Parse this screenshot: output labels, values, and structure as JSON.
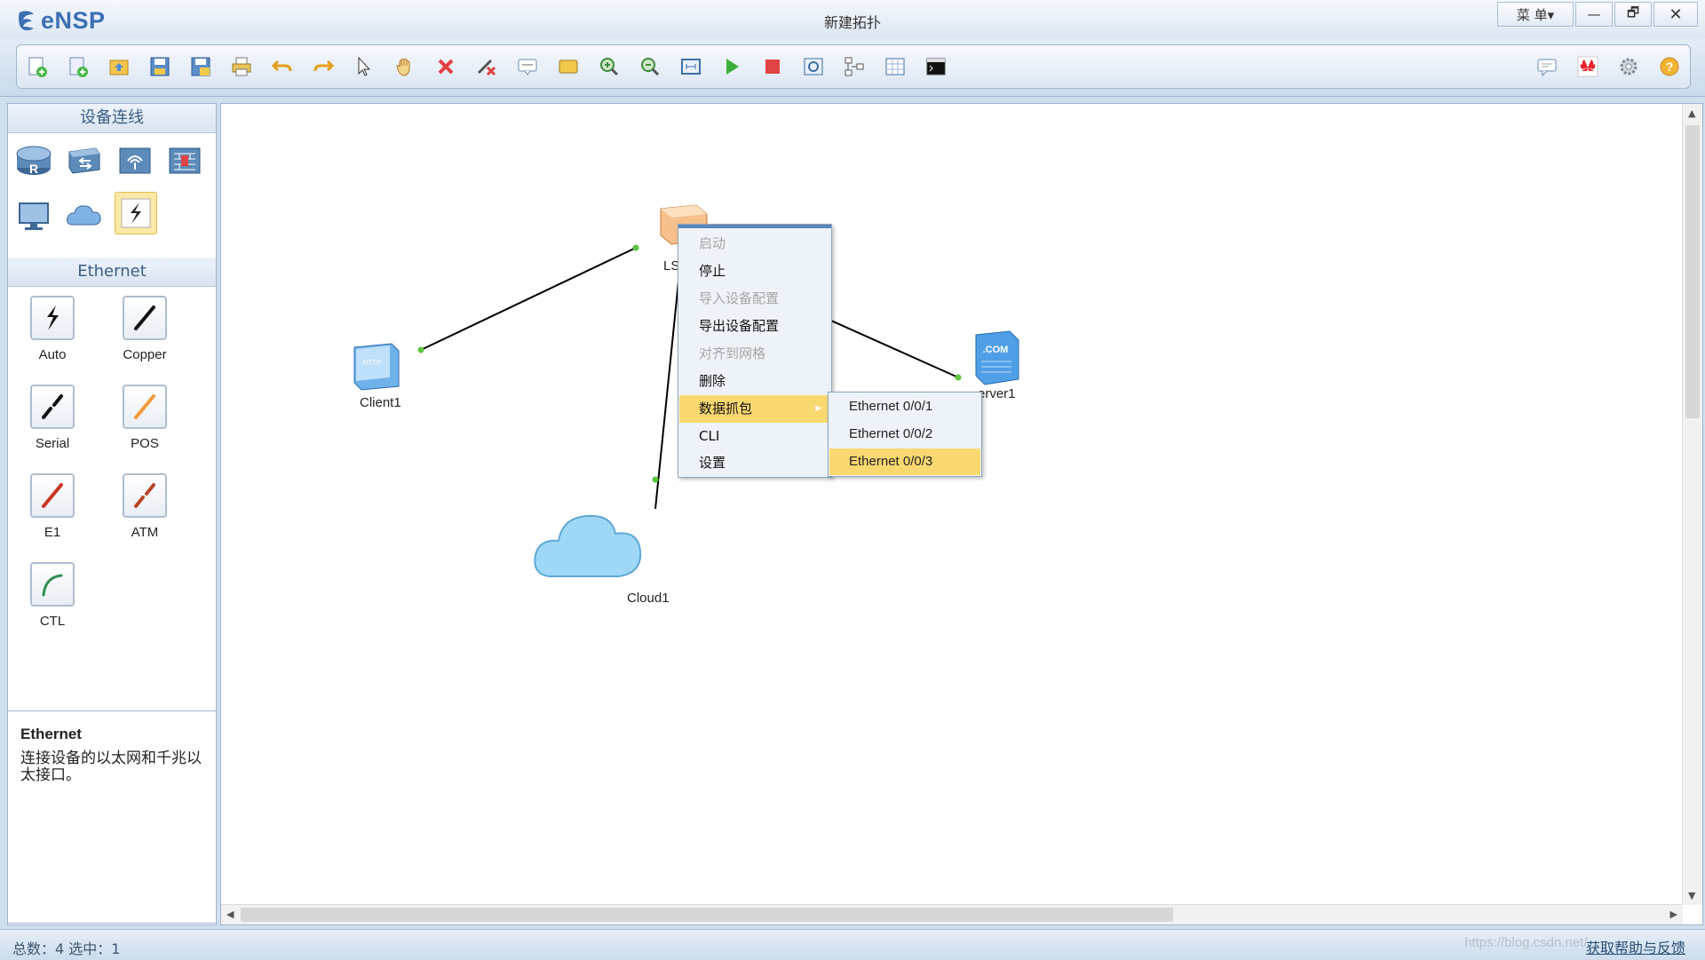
{
  "app": {
    "name": "eNSP",
    "title": "新建拓扑"
  },
  "window_controls": {
    "menu": "菜 单▾",
    "minimize": "—",
    "maximize": "🗗",
    "close": "✕"
  },
  "toolbar": {
    "left_icons": [
      "new-topology-icon",
      "new-example-icon",
      "open-icon",
      "save-icon",
      "save-as-icon",
      "print-icon",
      "undo-icon",
      "redo-icon",
      "select-pointer-icon",
      "pan-hand-icon",
      "delete-icon",
      "delete-link-icon",
      "text-annotation-icon",
      "palette-icon",
      "zoom-in-icon",
      "zoom-out-icon",
      "fit-view-icon",
      "start-device-icon",
      "stop-device-icon",
      "capture-icon",
      "topology-icon",
      "grid-table-icon",
      "terminal-icon"
    ],
    "right_icons": [
      "chat-icon",
      "huawei-logo-icon",
      "settings-gear-icon",
      "help-icon"
    ]
  },
  "left_panel": {
    "devices_header": "设备连线",
    "device_icons": [
      "router-icon",
      "switch-icon",
      "wlan-icon",
      "firewall-icon",
      "pc-icon",
      "cloud-icon",
      "connection-auto-icon"
    ],
    "ethernet_header": "Ethernet",
    "cables": [
      {
        "label": "Auto",
        "icon": "auto-cable-icon"
      },
      {
        "label": "Copper",
        "icon": "copper-cable-icon"
      },
      {
        "label": "Serial",
        "icon": "serial-cable-icon"
      },
      {
        "label": "POS",
        "icon": "pos-cable-icon"
      },
      {
        "label": "E1",
        "icon": "e1-cable-icon"
      },
      {
        "label": "ATM",
        "icon": "atm-cable-icon"
      },
      {
        "label": "CTL",
        "icon": "ctl-cable-icon"
      }
    ],
    "description": {
      "title": "Ethernet",
      "text": "连接设备的以太网和千兆以太接口。"
    }
  },
  "topology": {
    "nodes": [
      {
        "id": "client1",
        "label": "Client1",
        "icon": "http-client-icon"
      },
      {
        "id": "lsw",
        "label": "LS",
        "icon": "switch-device-icon"
      },
      {
        "id": "server1",
        "label": "erver1",
        "icon": "com-server-icon"
      },
      {
        "id": "cloud1",
        "label": "Cloud1",
        "icon": "cloud-device-icon"
      }
    ]
  },
  "context_menu": {
    "items": [
      {
        "label": "启动",
        "state": "disabled"
      },
      {
        "label": "停止",
        "state": "enabled"
      },
      {
        "label": "导入设备配置",
        "state": "disabled"
      },
      {
        "label": "导出设备配置",
        "state": "enabled"
      },
      {
        "label": "对齐到网格",
        "state": "disabled"
      },
      {
        "label": "删除",
        "state": "enabled"
      },
      {
        "label": "数据抓包",
        "state": "highlighted",
        "submenu_arrow": "▶"
      },
      {
        "label": "CLI",
        "state": "enabled"
      },
      {
        "label": "设置",
        "state": "enabled"
      }
    ],
    "submenu": [
      "Ethernet 0/0/1",
      "Ethernet 0/0/2",
      "Ethernet 0/0/3"
    ],
    "submenu_highlighted": "Ethernet 0/0/3"
  },
  "status_bar": {
    "text": "总数：4  选中：1",
    "watermark": "https://blog.csdn.net/...",
    "help_link": "获取帮助与反馈"
  },
  "colors": {
    "accent": "#3c6fb5",
    "highlight": "#fad870",
    "link_dot": "#5cc63f"
  }
}
